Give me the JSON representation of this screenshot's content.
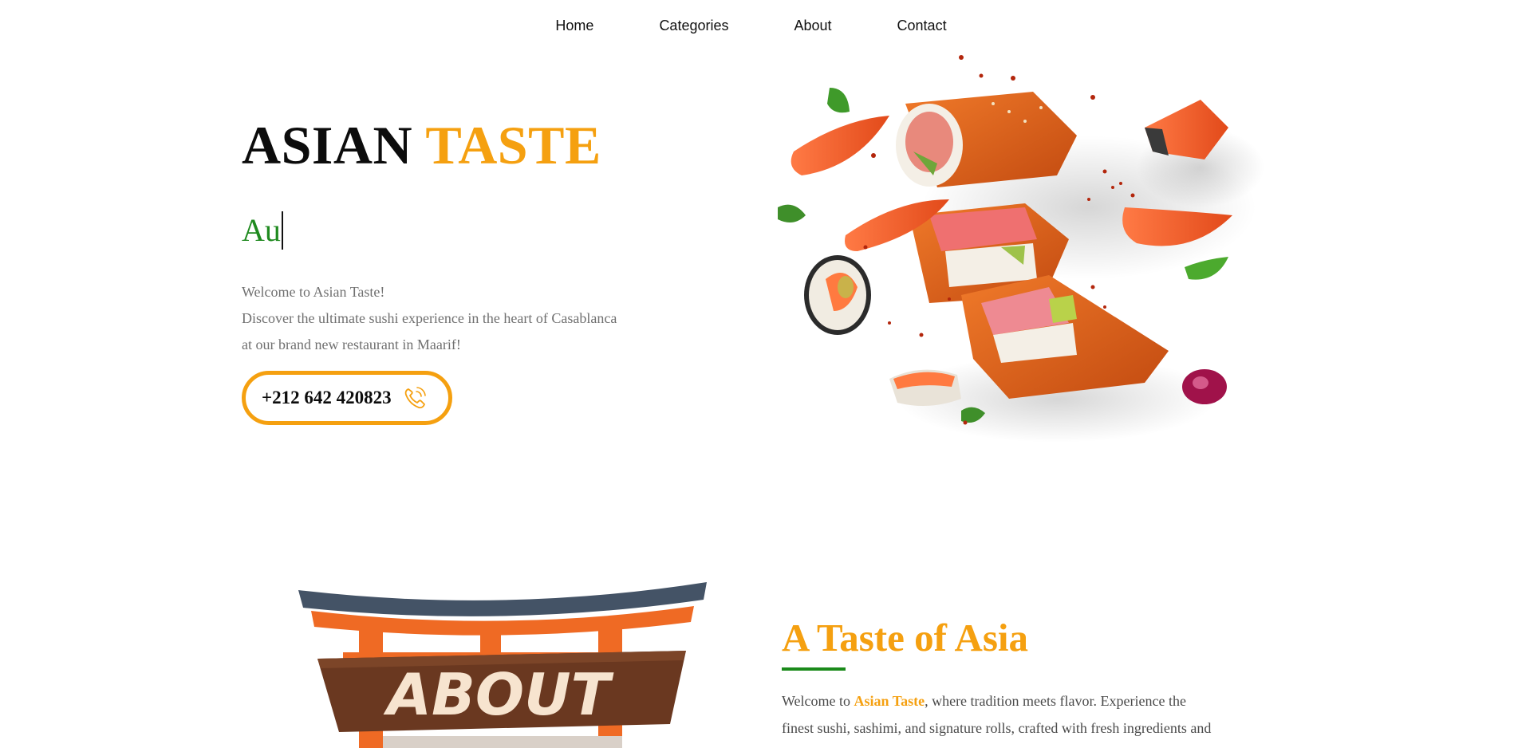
{
  "nav": {
    "items": [
      {
        "label": "Home"
      },
      {
        "label": "Categories"
      },
      {
        "label": "About"
      },
      {
        "label": "Contact"
      }
    ]
  },
  "hero": {
    "brand_part1": "ASIAN",
    "brand_part2": "TASTE",
    "typed_text": "Au",
    "intro_line1": "Welcome to Asian Taste!",
    "intro_line2": "Discover the ultimate sushi experience in the heart of Casablanca",
    "intro_line3": "at our brand new restaurant in Maarif!",
    "phone": "+212 642 420823"
  },
  "about": {
    "sign_text": "ABOUT",
    "title": "A Taste of Asia",
    "text_prefix": "Welcome to ",
    "text_highlight": "Asian Taste",
    "text_after": ", where tradition meets flavor. Experience the",
    "text_line2": "finest sushi, sashimi, and signature rolls, crafted with fresh ingredients and"
  },
  "colors": {
    "accent": "#f5a010",
    "green": "#1f8a1f",
    "text_muted": "#707070"
  }
}
